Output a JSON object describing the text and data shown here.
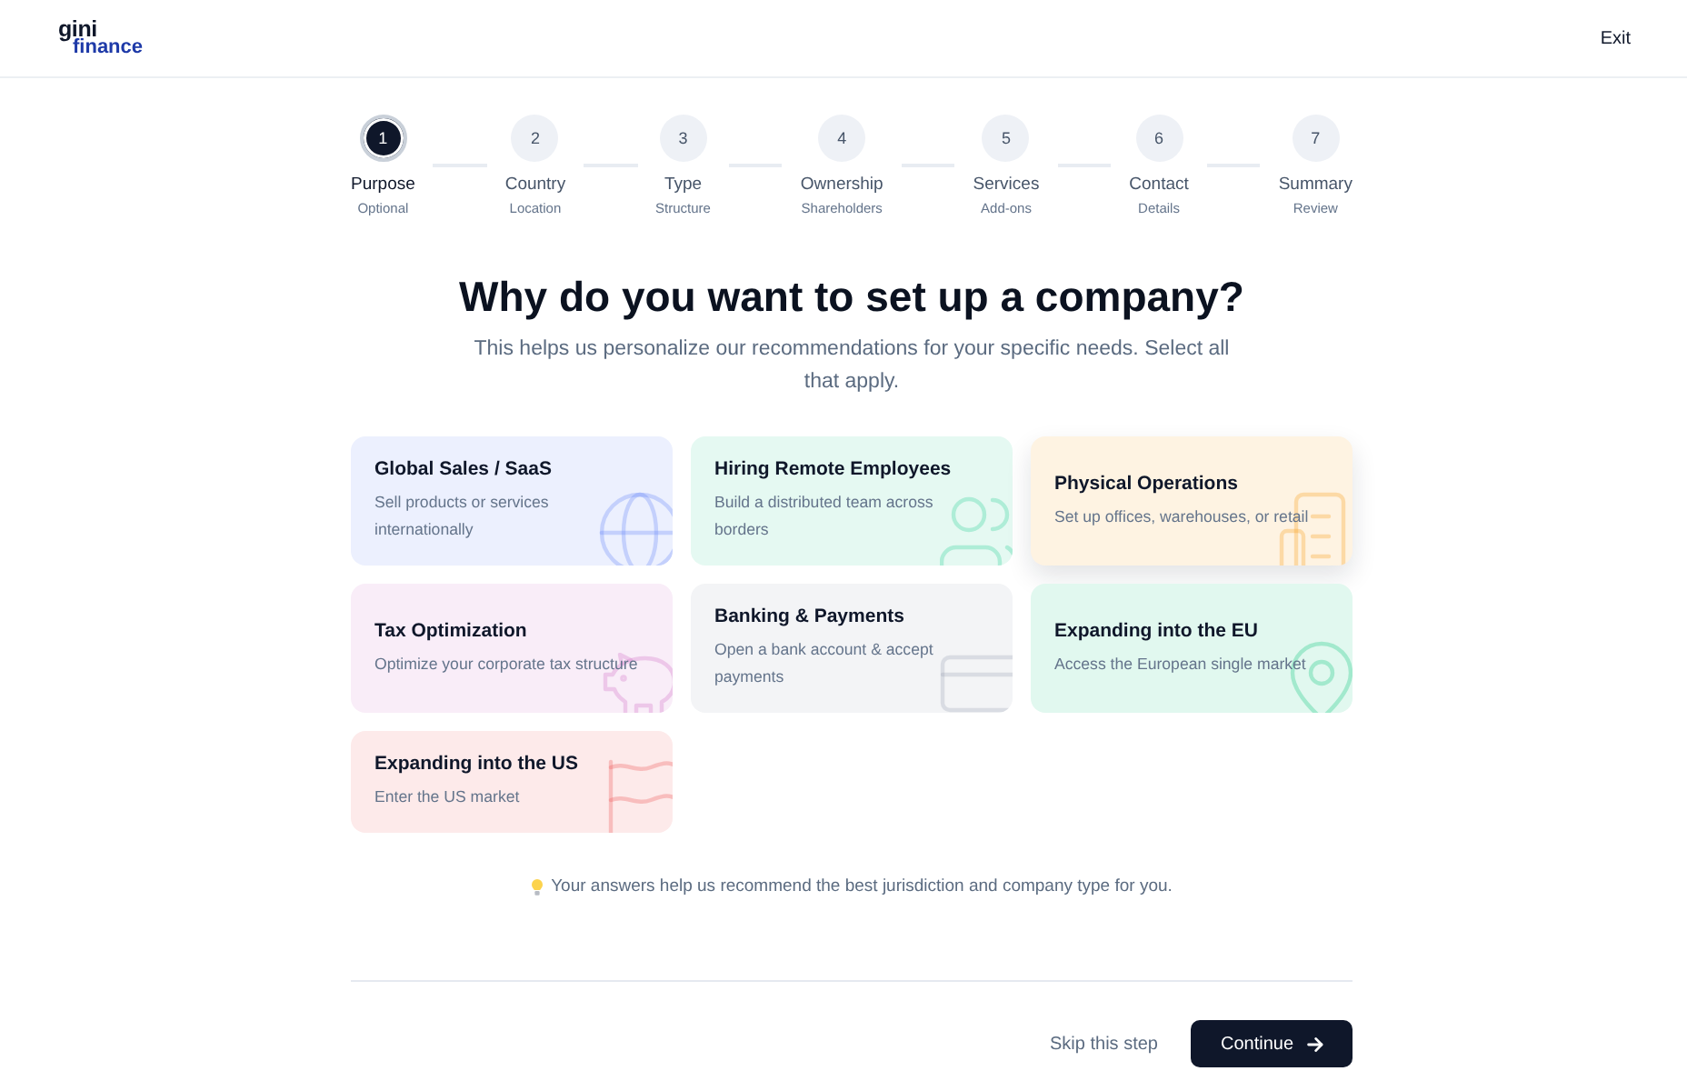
{
  "header": {
    "logo": {
      "top": "gini",
      "bottom": "finance"
    },
    "exit": "Exit"
  },
  "steps": [
    {
      "number": "1",
      "label": "Purpose",
      "sublabel": "Optional",
      "selected": true
    },
    {
      "number": "2",
      "label": "Country",
      "sublabel": "Location",
      "selected": false
    },
    {
      "number": "3",
      "label": "Type",
      "sublabel": "Structure",
      "selected": false
    },
    {
      "number": "4",
      "label": "Ownership",
      "sublabel": "Shareholders",
      "selected": false
    },
    {
      "number": "5",
      "label": "Services",
      "sublabel": "Add-ons",
      "selected": false
    },
    {
      "number": "6",
      "label": "Contact",
      "sublabel": "Details",
      "selected": false
    },
    {
      "number": "7",
      "label": "Summary",
      "sublabel": "Review",
      "selected": false
    }
  ],
  "question": {
    "title": "Why do you want to set up a company?",
    "subtitle": "This helps us personalize our recommendations for your specific needs. Select all that apply."
  },
  "cards": [
    {
      "title": "Global Sales / SaaS",
      "description": "Sell products or services internationally",
      "color": "#ecf0fe",
      "selected": false
    },
    {
      "title": "Hiring Remote Employees",
      "description": "Build a distributed team across borders",
      "color": "#e5f9f2",
      "selected": false
    },
    {
      "title": "Physical Operations",
      "description": "Set up offices, warehouses, or retail",
      "color": "#fef3e2",
      "selected": true
    },
    {
      "title": "Tax Optimization",
      "description": "Optimize your corporate tax structure",
      "color": "#f9edf8",
      "selected": false
    },
    {
      "title": "Banking & Payments",
      "description": "Open a bank account & accept payments",
      "color": "#f3f4f6",
      "selected": false
    },
    {
      "title": "Expanding into the EU",
      "description": "Access the European single market",
      "color": "#e1f8ef",
      "selected": false
    },
    {
      "title": "Expanding into the US",
      "description": "Enter the US market",
      "color": "#fdeaea",
      "selected": false
    }
  ],
  "hint": "Your answers help us recommend the best jurisdiction and company type for you.",
  "footer": {
    "skip": "Skip this step",
    "continue": "Continue"
  }
}
